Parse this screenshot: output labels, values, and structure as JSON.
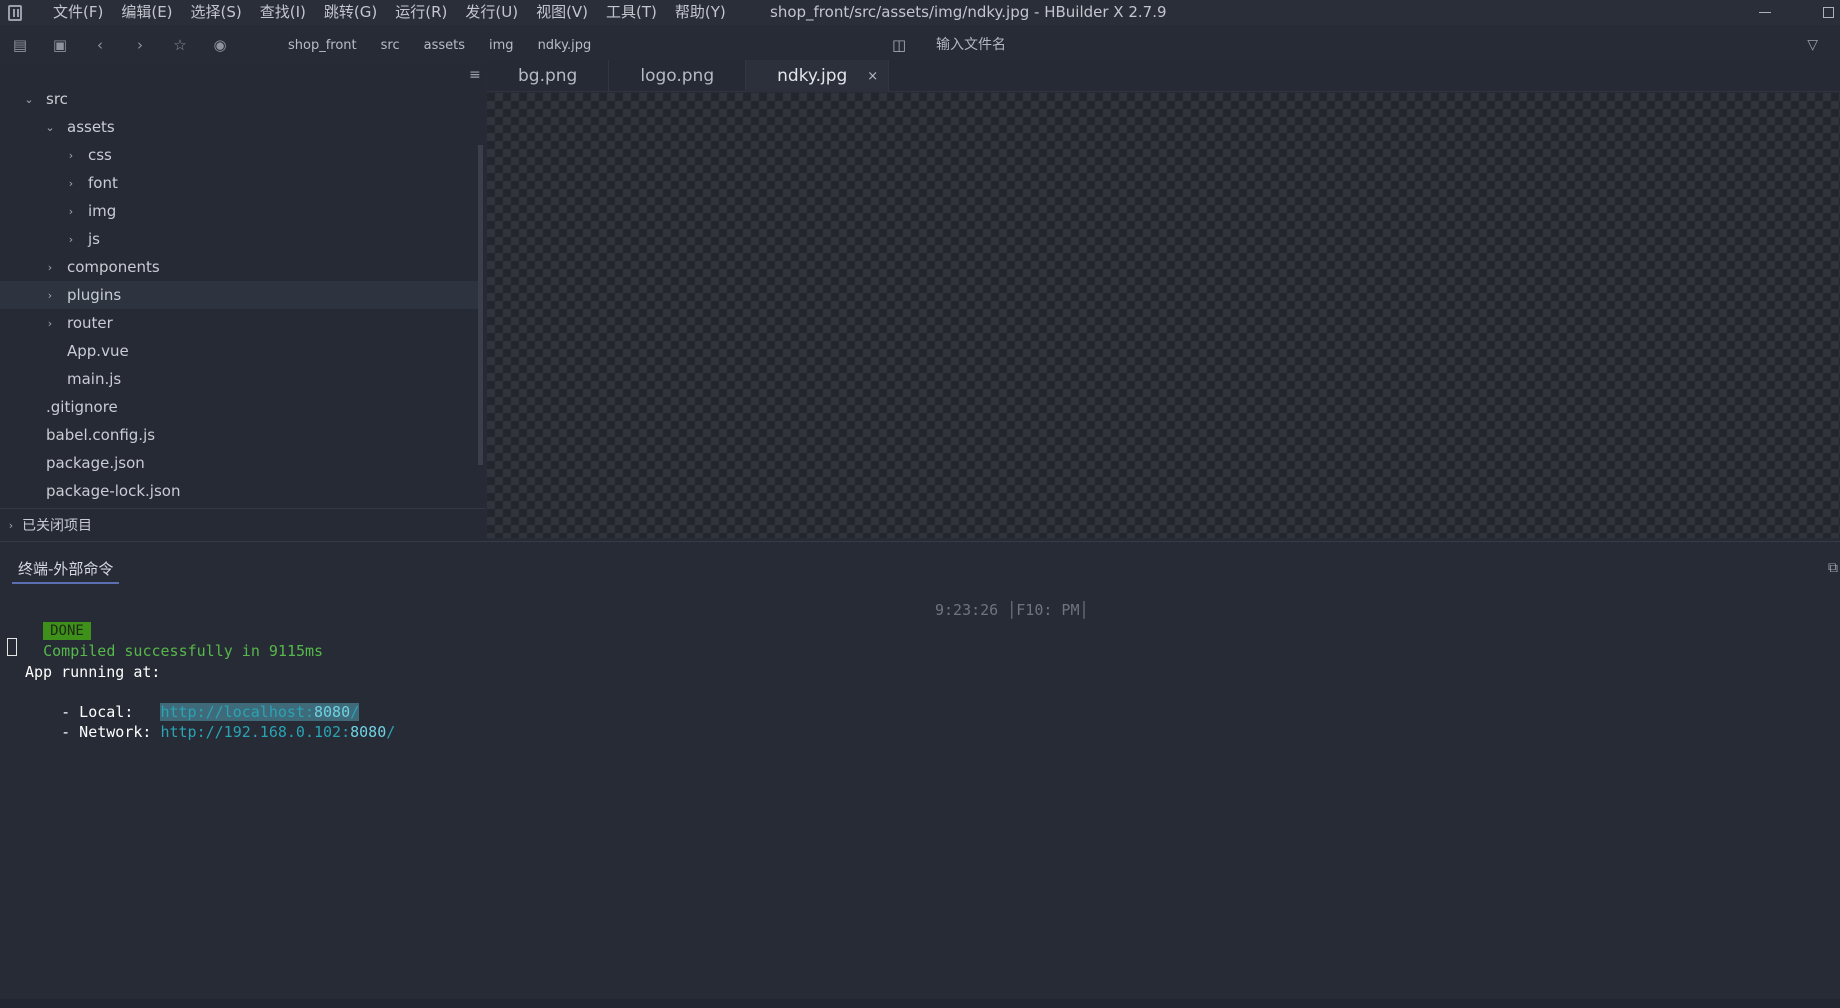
{
  "menu": [
    "文件(F)",
    "编辑(E)",
    "选择(S)",
    "查找(I)",
    "跳转(G)",
    "运行(R)",
    "发行(U)",
    "视图(V)",
    "工具(T)",
    "帮助(Y)"
  ],
  "window_title": "shop_front/src/assets/img/ndky.jpg - HBuilder X 2.7.9",
  "breadcrumb": [
    "shop_front",
    "src",
    "assets",
    "img",
    "ndky.jpg"
  ],
  "file_search": {
    "placeholder": "输入文件名"
  },
  "tree": [
    {
      "label": "src",
      "chevron": "⌄",
      "depth": 1
    },
    {
      "label": "assets",
      "chevron": "⌄",
      "depth": 2
    },
    {
      "label": "css",
      "chevron": "›",
      "depth": 3
    },
    {
      "label": "font",
      "chevron": "›",
      "depth": 3
    },
    {
      "label": "img",
      "chevron": "›",
      "depth": 3
    },
    {
      "label": "js",
      "chevron": "›",
      "depth": 3
    },
    {
      "label": "components",
      "chevron": "›",
      "depth": 2
    },
    {
      "label": "plugins",
      "chevron": "›",
      "depth": 2
    },
    {
      "label": "router",
      "chevron": "›",
      "depth": 2
    },
    {
      "label": "App.vue",
      "chevron": "",
      "depth": 2
    },
    {
      "label": "main.js",
      "chevron": "",
      "depth": 2
    },
    {
      "label": ".gitignore",
      "chevron": "",
      "depth": 1
    },
    {
      "label": "babel.config.js",
      "chevron": "",
      "depth": 1
    },
    {
      "label": "package.json",
      "chevron": "",
      "depth": 1
    },
    {
      "label": "package-lock.json",
      "chevron": "",
      "depth": 1
    }
  ],
  "closed_projects": "已关闭项目",
  "tabs": [
    {
      "label": "bg.png",
      "active": false
    },
    {
      "label": "logo.png",
      "active": false
    },
    {
      "label": "ndky.jpg",
      "active": true
    }
  ],
  "tab_close_glyph": "×",
  "terminal": {
    "tab_label": "终端-外部命令",
    "done": "DONE",
    "compiled": "Compiled successfully in 9115ms",
    "time": "9:23:26 │F10: PM│",
    "app_running": "App running at:",
    "local_label": "- Local:   ",
    "local_url_a": "http://localhost:",
    "local_url_port": "8080",
    "local_url_b": "/",
    "network_label": "- Network: ",
    "network_url_a": "http://192.168.0.102:",
    "network_url_port": "8080",
    "network_url_b": "/"
  },
  "colors": {
    "background": "#272b36",
    "done_badge": "#3f8f1b",
    "success_text": "#56b84a",
    "link": "#2aa3b4",
    "tab_underline": "#5a6eb0"
  }
}
